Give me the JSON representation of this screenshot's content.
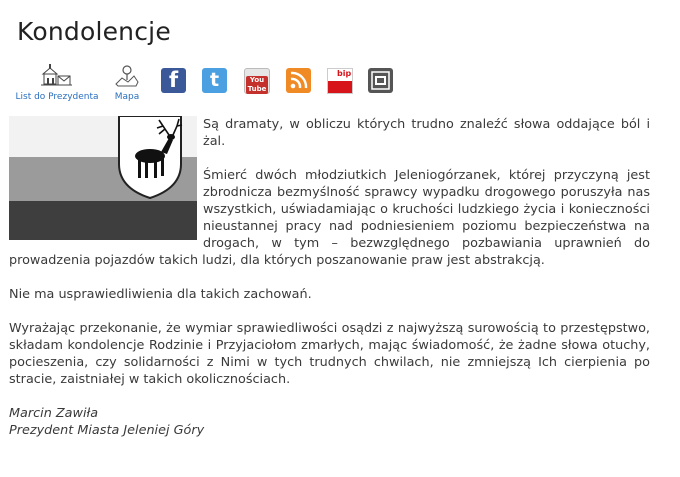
{
  "page": {
    "title": "Kondolencje"
  },
  "toolbar": {
    "letter": {
      "label": "List do Prezydenta",
      "icon": "town-hall-letter-icon"
    },
    "map": {
      "label": "Mapa",
      "icon": "map-pin-icon"
    },
    "facebook": {
      "glyph": "f",
      "color": "#3b5998"
    },
    "twitter": {
      "glyph": "t",
      "color": "#4aa0e0"
    },
    "youtube": {
      "glyph": "You Tube",
      "color": "#c4302b"
    },
    "rss": {
      "color": "#f08a24"
    },
    "bip": {
      "glyph": "bip",
      "color": "#d8141b"
    },
    "gazette": {
      "color": "#555555"
    }
  },
  "crest": {
    "shield_color": "#ffffff",
    "flag_top": "#f2f2f2",
    "flag_mid": "#9b9b9b",
    "flag_bottom": "#3e3e3e"
  },
  "content": {
    "p1": "Są dramaty, w obliczu których trudno znaleźć słowa oddające ból i żal.",
    "p2": "Śmierć dwóch młodziutkich Jeleniogórzanek, której przyczyną jest zbrodnicza bezmyślność sprawcy wypadku drogowego poruszyła nas wszystkich, uświadamiając o kruchości ludzkiego życia i konieczności nieustannej pracy nad podniesieniem poziomu bezpieczeństwa na drogach, w tym – bezwzględnego pozbawiania uprawnień do prowadzenia pojazdów takich ludzi, dla których poszanowanie praw jest abstrakcją.",
    "p3": "Nie ma usprawiedliwienia dla takich zachowań.",
    "p4": "Wyrażając przekonanie, że wymiar sprawiedliwości osądzi z najwyższą surowością to przestępstwo, składam kondolencje Rodzinie i Przyjaciołom zmarłych, mając świadomość, że żadne słowa otuchy, pocieszenia, czy solidarności z Nimi w tych trudnych chwilach, nie zmniejszą Ich cierpienia po stracie, zaistniałej w takich okolicznościach.",
    "signature_name": "Marcin Zawiła",
    "signature_title": "Prezydent Miasta Jeleniej Góry"
  }
}
